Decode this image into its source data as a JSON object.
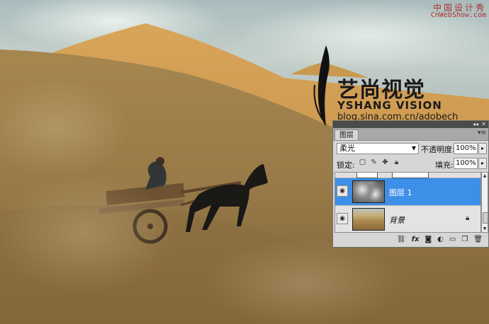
{
  "watermark": {
    "cn": "艺尚视觉",
    "en": "YSHANG VISION",
    "url": "blog.sina.com.cn/adobech"
  },
  "site": {
    "cn": "中国设计秀",
    "en": "CnWebShow.com"
  },
  "panel": {
    "topbar": {
      "collapse": "◂◂",
      "close": "✕"
    },
    "tab": "图层",
    "menu_icon": "▾≡",
    "blend_mode": "柔光",
    "opacity_label": "不透明度:",
    "opacity_value": "100%",
    "lock_label": "锁定:",
    "fill_label": "填充:",
    "fill_value": "100%",
    "layers": [
      {
        "name": "图层 1",
        "selected": true,
        "thumb": "cloud-texture"
      },
      {
        "name": "背景",
        "selected": false,
        "thumb": "desert-photo",
        "locked": true
      }
    ],
    "icons": {
      "visibility": "eye-icon",
      "lock": "lock-icon",
      "bottom": [
        "link-icon",
        "fx-icon",
        "mask-icon",
        "adjustment-icon",
        "group-folder-icon",
        "new-layer-icon",
        "trash-icon"
      ]
    }
  }
}
